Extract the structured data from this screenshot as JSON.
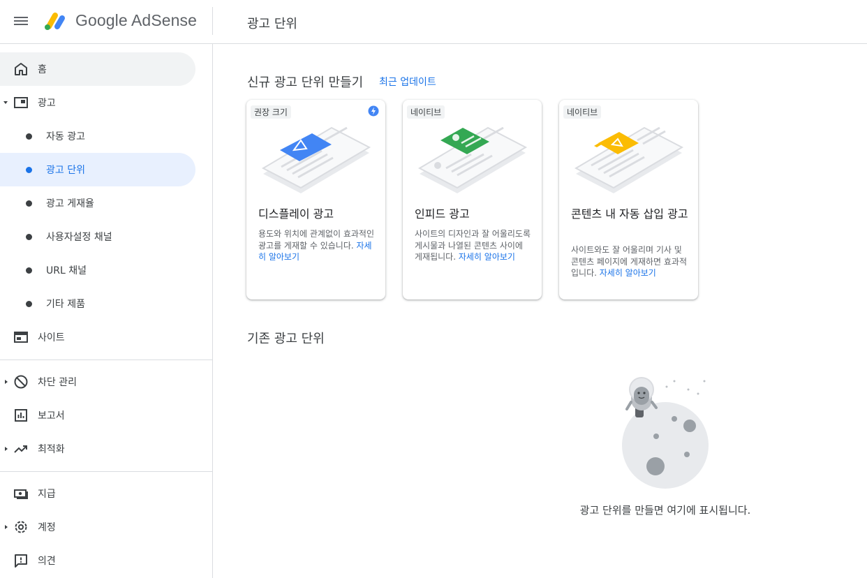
{
  "header": {
    "brand": "Google AdSense",
    "title": "광고 단위"
  },
  "sidebar": {
    "items": [
      {
        "label": "홈",
        "icon": "home-icon"
      },
      {
        "label": "광고",
        "icon": "ad-icon"
      },
      {
        "label": "자동 광고"
      },
      {
        "label": "광고 단위"
      },
      {
        "label": "광고 게재율"
      },
      {
        "label": "사용자설정 채널"
      },
      {
        "label": "URL 채널"
      },
      {
        "label": "기타 제품"
      },
      {
        "label": "사이트",
        "icon": "site-icon"
      },
      {
        "label": "차단 관리",
        "icon": "block-icon"
      },
      {
        "label": "보고서",
        "icon": "report-icon"
      },
      {
        "label": "최적화",
        "icon": "trending-icon"
      },
      {
        "label": "지급",
        "icon": "payments-icon"
      },
      {
        "label": "계정",
        "icon": "gear-icon"
      },
      {
        "label": "의견",
        "icon": "feedback-icon"
      }
    ]
  },
  "main": {
    "create_title": "신규 광고 단위 만들기",
    "updates_link": "최근 업데이트",
    "cards": [
      {
        "chip": "권장 크기",
        "title": "디스플레이 광고",
        "desc": "용도와 위치에 관계없이 효과적인 광고를 게재할 수 있습니다. ",
        "more": "자세히 알아보기",
        "accent": "#4285f4"
      },
      {
        "chip": "네이티브",
        "title": "인피드 광고",
        "desc": "사이트의 디자인과 잘 어울리도록 게시물과 나열된 콘텐츠 사이에 게재됩니다. ",
        "more": "자세히 알아보기",
        "accent": "#34a853"
      },
      {
        "chip": "네이티브",
        "title": "콘텐츠 내 자동 삽입 광고",
        "desc": "사이트와도 잘 어울리며 기사 및 콘텐츠 페이지에 게재하면 효과적입니다. ",
        "more": "자세히 알아보기",
        "accent": "#fbbc04"
      }
    ],
    "existing_title": "기존 광고 단위",
    "empty_text": "광고 단위를 만들면 여기에 표시됩니다."
  }
}
